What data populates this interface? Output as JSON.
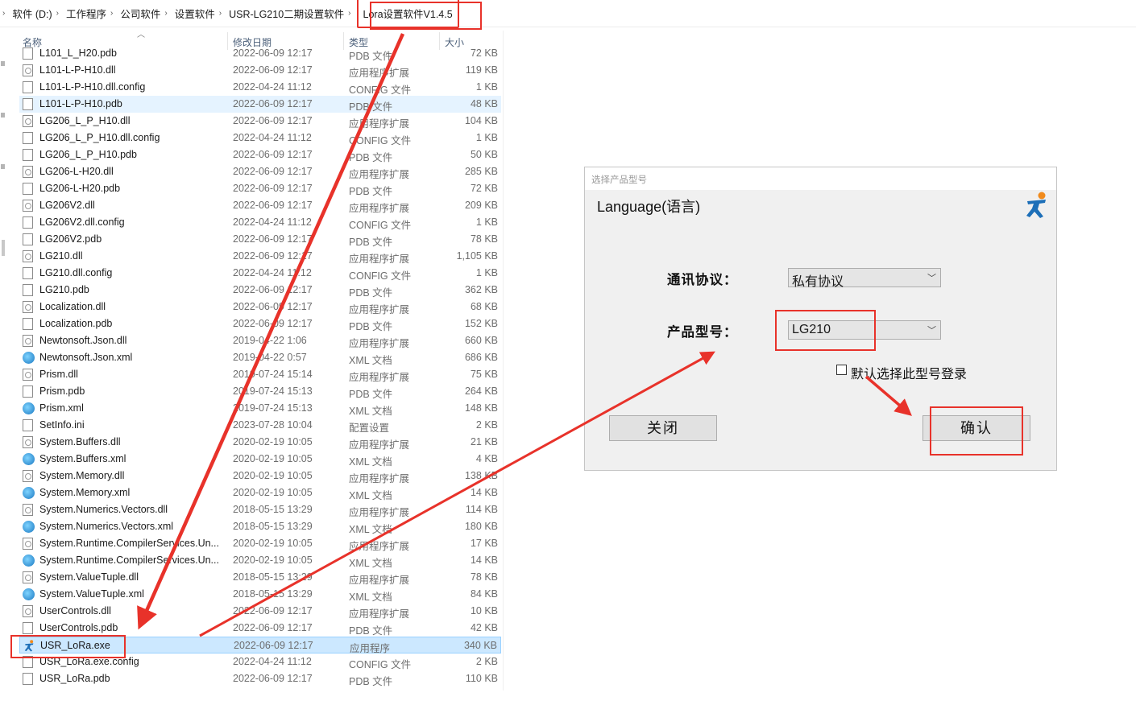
{
  "breadcrumb": [
    "软件 (D:)",
    "工作程序",
    "公司软件",
    "设置软件",
    "USR-LG210二期设置软件",
    "Lora设置软件V1.4.5"
  ],
  "columns": {
    "name": "名称",
    "date": "修改日期",
    "type": "类型",
    "size": "大小"
  },
  "files": [
    {
      "name": "L101_L_H20.pdb",
      "date": "2022-06-09 12:17",
      "type": "PDB 文件",
      "size": "72 KB",
      "icon": "file-icon"
    },
    {
      "name": "L101-L-P-H10.dll",
      "date": "2022-06-09 12:17",
      "type": "应用程序扩展",
      "size": "119 KB",
      "icon": "dll-icon"
    },
    {
      "name": "L101-L-P-H10.dll.config",
      "date": "2022-04-24 11:12",
      "type": "CONFIG 文件",
      "size": "1 KB",
      "icon": "file-icon"
    },
    {
      "name": "L101-L-P-H10.pdb",
      "date": "2022-06-09 12:17",
      "type": "PDB 文件",
      "size": "48 KB",
      "icon": "file-icon"
    },
    {
      "name": "LG206_L_P_H10.dll",
      "date": "2022-06-09 12:17",
      "type": "应用程序扩展",
      "size": "104 KB",
      "icon": "dll-icon"
    },
    {
      "name": "LG206_L_P_H10.dll.config",
      "date": "2022-04-24 11:12",
      "type": "CONFIG 文件",
      "size": "1 KB",
      "icon": "file-icon"
    },
    {
      "name": "LG206_L_P_H10.pdb",
      "date": "2022-06-09 12:17",
      "type": "PDB 文件",
      "size": "50 KB",
      "icon": "file-icon"
    },
    {
      "name": "LG206-L-H20.dll",
      "date": "2022-06-09 12:17",
      "type": "应用程序扩展",
      "size": "285 KB",
      "icon": "dll-icon"
    },
    {
      "name": "LG206-L-H20.pdb",
      "date": "2022-06-09 12:17",
      "type": "PDB 文件",
      "size": "72 KB",
      "icon": "file-icon"
    },
    {
      "name": "LG206V2.dll",
      "date": "2022-06-09 12:17",
      "type": "应用程序扩展",
      "size": "209 KB",
      "icon": "dll-icon"
    },
    {
      "name": "LG206V2.dll.config",
      "date": "2022-04-24 11:12",
      "type": "CONFIG 文件",
      "size": "1 KB",
      "icon": "file-icon"
    },
    {
      "name": "LG206V2.pdb",
      "date": "2022-06-09 12:17",
      "type": "PDB 文件",
      "size": "78 KB",
      "icon": "file-icon"
    },
    {
      "name": "LG210.dll",
      "date": "2022-06-09 12:17",
      "type": "应用程序扩展",
      "size": "1,105 KB",
      "icon": "dll-icon"
    },
    {
      "name": "LG210.dll.config",
      "date": "2022-04-24 11:12",
      "type": "CONFIG 文件",
      "size": "1 KB",
      "icon": "file-icon"
    },
    {
      "name": "LG210.pdb",
      "date": "2022-06-09 12:17",
      "type": "PDB 文件",
      "size": "362 KB",
      "icon": "file-icon"
    },
    {
      "name": "Localization.dll",
      "date": "2022-06-09 12:17",
      "type": "应用程序扩展",
      "size": "68 KB",
      "icon": "dll-icon"
    },
    {
      "name": "Localization.pdb",
      "date": "2022-06-09 12:17",
      "type": "PDB 文件",
      "size": "152 KB",
      "icon": "file-icon"
    },
    {
      "name": "Newtonsoft.Json.dll",
      "date": "2019-04-22 1:06",
      "type": "应用程序扩展",
      "size": "660 KB",
      "icon": "dll-icon"
    },
    {
      "name": "Newtonsoft.Json.xml",
      "date": "2019-04-22 0:57",
      "type": "XML 文档",
      "size": "686 KB",
      "icon": "xml-icon"
    },
    {
      "name": "Prism.dll",
      "date": "2019-07-24 15:14",
      "type": "应用程序扩展",
      "size": "75 KB",
      "icon": "dll-icon"
    },
    {
      "name": "Prism.pdb",
      "date": "2019-07-24 15:13",
      "type": "PDB 文件",
      "size": "264 KB",
      "icon": "file-icon"
    },
    {
      "name": "Prism.xml",
      "date": "2019-07-24 15:13",
      "type": "XML 文档",
      "size": "148 KB",
      "icon": "xml-icon"
    },
    {
      "name": "SetInfo.ini",
      "date": "2023-07-28 10:04",
      "type": "配置设置",
      "size": "2 KB",
      "icon": "file-icon"
    },
    {
      "name": "System.Buffers.dll",
      "date": "2020-02-19 10:05",
      "type": "应用程序扩展",
      "size": "21 KB",
      "icon": "dll-icon"
    },
    {
      "name": "System.Buffers.xml",
      "date": "2020-02-19 10:05",
      "type": "XML 文档",
      "size": "4 KB",
      "icon": "xml-icon"
    },
    {
      "name": "System.Memory.dll",
      "date": "2020-02-19 10:05",
      "type": "应用程序扩展",
      "size": "138 KB",
      "icon": "dll-icon"
    },
    {
      "name": "System.Memory.xml",
      "date": "2020-02-19 10:05",
      "type": "XML 文档",
      "size": "14 KB",
      "icon": "xml-icon"
    },
    {
      "name": "System.Numerics.Vectors.dll",
      "date": "2018-05-15 13:29",
      "type": "应用程序扩展",
      "size": "114 KB",
      "icon": "dll-icon"
    },
    {
      "name": "System.Numerics.Vectors.xml",
      "date": "2018-05-15 13:29",
      "type": "XML 文档",
      "size": "180 KB",
      "icon": "xml-icon"
    },
    {
      "name": "System.Runtime.CompilerServices.Un...",
      "date": "2020-02-19 10:05",
      "type": "应用程序扩展",
      "size": "17 KB",
      "icon": "dll-icon"
    },
    {
      "name": "System.Runtime.CompilerServices.Un...",
      "date": "2020-02-19 10:05",
      "type": "XML 文档",
      "size": "14 KB",
      "icon": "xml-icon"
    },
    {
      "name": "System.ValueTuple.dll",
      "date": "2018-05-15 13:29",
      "type": "应用程序扩展",
      "size": "78 KB",
      "icon": "dll-icon"
    },
    {
      "name": "System.ValueTuple.xml",
      "date": "2018-05-15 13:29",
      "type": "XML 文档",
      "size": "84 KB",
      "icon": "xml-icon"
    },
    {
      "name": "UserControls.dll",
      "date": "2022-06-09 12:17",
      "type": "应用程序扩展",
      "size": "10 KB",
      "icon": "dll-icon"
    },
    {
      "name": "UserControls.pdb",
      "date": "2022-06-09 12:17",
      "type": "PDB 文件",
      "size": "42 KB",
      "icon": "file-icon"
    },
    {
      "name": "USR_LoRa.exe",
      "date": "2022-06-09 12:17",
      "type": "应用程序",
      "size": "340 KB",
      "icon": "app-icon"
    },
    {
      "name": "USR_LoRa.exe.config",
      "date": "2022-04-24 11:12",
      "type": "CONFIG 文件",
      "size": "2 KB",
      "icon": "file-icon"
    },
    {
      "name": "USR_LoRa.pdb",
      "date": "2022-06-09 12:17",
      "type": "PDB 文件",
      "size": "110 KB",
      "icon": "file-icon"
    }
  ],
  "hover_index": 3,
  "selected_index": 35,
  "dialog": {
    "title": "选择产品型号",
    "language_label": "Language(语言)",
    "protocol_label": "通讯协议：",
    "protocol_value": "私有协议",
    "model_label": "产品型号：",
    "model_value": "LG210",
    "default_checkbox_label": "默认选择此型号登录",
    "default_checked": false,
    "close_button": "关闭",
    "confirm_button": "确认"
  },
  "colors": {
    "annotation": "#e8322a",
    "selected_row": "#cce8ff",
    "hover_row": "#e5f3ff"
  }
}
